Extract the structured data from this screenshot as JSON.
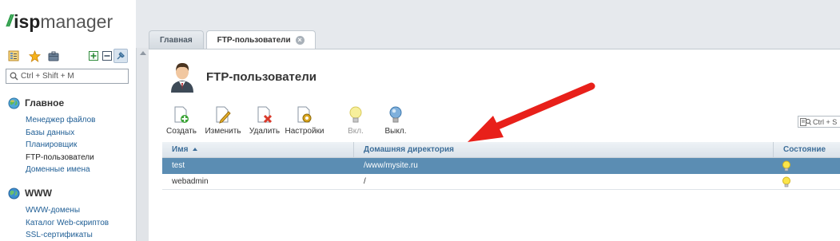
{
  "logo": {
    "mark": "//",
    "part1": "isp",
    "part2": "manager"
  },
  "sidebar": {
    "search_placeholder": "Ctrl + Shift + M",
    "groups": [
      {
        "title": "Главное",
        "icon": "globe-green-icon",
        "items": [
          "Менеджер файлов",
          "Базы данных",
          "Планировщик",
          "FTP-пользователи",
          "Доменные имена"
        ]
      },
      {
        "title": "WWW",
        "icon": "globe-blue-icon",
        "items": [
          "WWW-домены",
          "Каталог Web-скриптов",
          "SSL-сертификаты"
        ]
      }
    ]
  },
  "tabs": [
    {
      "label": "Главная"
    },
    {
      "label": "FTP-пользователи",
      "closable": true
    }
  ],
  "main": {
    "title": "FTP-пользователи",
    "toolbar": [
      {
        "label": "Создать",
        "icon": "create-icon"
      },
      {
        "label": "Изменить",
        "icon": "edit-icon"
      },
      {
        "label": "Удалить",
        "icon": "delete-icon"
      },
      {
        "label": "Настройки",
        "icon": "settings-icon"
      },
      {
        "label": "Вкл.",
        "icon": "bulb-on-icon",
        "disabled": true
      },
      {
        "label": "Выкл.",
        "icon": "bulb-off-icon"
      }
    ],
    "search_placeholder": "Ctrl + S",
    "table": {
      "columns": [
        "Имя",
        "Домашняя директория",
        "Состояние"
      ],
      "sort": "Имя ascending",
      "rows": [
        {
          "name": "test",
          "home": "/www/mysite.ru",
          "state": "bulb-on-icon",
          "selected": true
        },
        {
          "name": "webadmin",
          "home": "/",
          "state": "bulb-on-icon",
          "selected": false
        }
      ]
    }
  },
  "annotation": {
    "type": "red-arrow",
    "color": "#e8201a",
    "points_to": "Домашняя директория column"
  }
}
